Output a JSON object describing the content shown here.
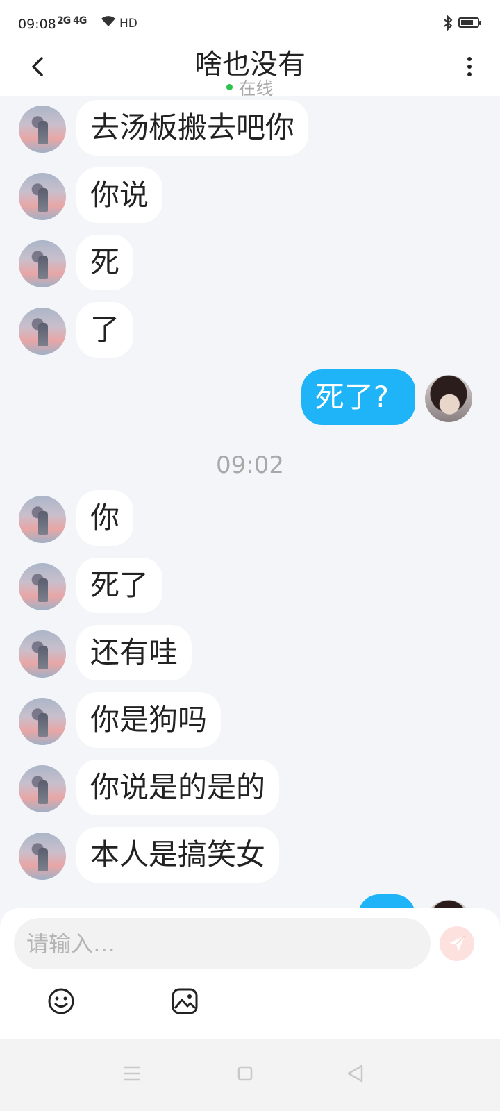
{
  "status_bar": {
    "time": "09:08",
    "network": "2G 4G",
    "hd": "HD",
    "battery_level": 0.75
  },
  "header": {
    "title": "啥也没有",
    "status": "在线",
    "status_color": "#2bc44f"
  },
  "messages": [
    {
      "side": "in",
      "text": "去汤板搬去吧你"
    },
    {
      "side": "in",
      "text": "你说"
    },
    {
      "side": "in",
      "text": "死"
    },
    {
      "side": "in",
      "text": "了"
    },
    {
      "side": "out",
      "text": "死了?"
    },
    {
      "side": "time",
      "text": "09:02"
    },
    {
      "side": "in",
      "text": "你"
    },
    {
      "side": "in",
      "text": "死了"
    },
    {
      "side": "in",
      "text": "还有哇"
    },
    {
      "side": "in",
      "text": "你是狗吗"
    },
    {
      "side": "in",
      "text": "你说是的是的"
    },
    {
      "side": "in",
      "text": "本人是搞笑女"
    },
    {
      "side": "out",
      "text": ""
    }
  ],
  "composer": {
    "placeholder": "请输入…",
    "value": "",
    "send_color": "#fde1df",
    "icons": [
      "emoji-icon",
      "image-icon",
      "send-icon"
    ]
  },
  "nav": {
    "icons": [
      "menu-icon",
      "home-icon",
      "back-icon"
    ]
  },
  "colors": {
    "outgoing_bubble": "#1fb3f7",
    "incoming_bubble": "#ffffff",
    "background": "#f4f5f8"
  }
}
